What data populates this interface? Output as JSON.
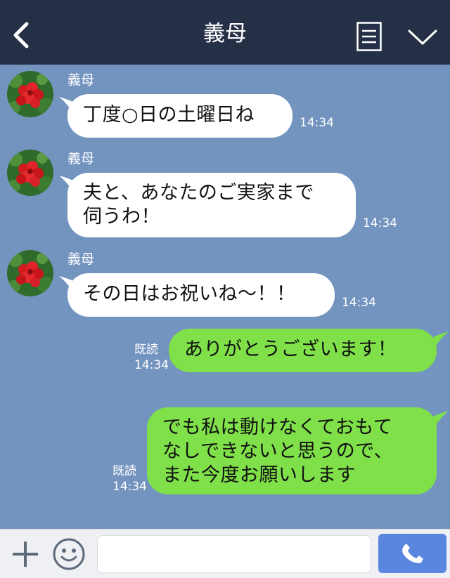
{
  "header": {
    "title": "義母",
    "back_icon": "chevron-left-icon",
    "menu_icon": "list-icon",
    "collapse_icon": "chevron-down-icon",
    "background": "#253047"
  },
  "chat": {
    "background": "#7494c0",
    "incoming": [
      {
        "sender": "義母",
        "text": "丁度○日の土曜日ね",
        "time": "14:34"
      },
      {
        "sender": "義母",
        "lines": [
          "夫と、あなたのご実家まで",
          "伺うわ！"
        ],
        "time": "14:34"
      },
      {
        "sender": "義母",
        "text": "その日はお祝いね〜！！",
        "time": "14:34"
      }
    ],
    "outgoing": [
      {
        "read_label": "既読",
        "text": "ありがとうございます！",
        "time": "14:34"
      },
      {
        "read_label": "既読",
        "lines": [
          "でも私は動けなくておもて",
          "なしできないと思うので、",
          "また今度お願いします"
        ],
        "time": "14:34"
      }
    ],
    "incoming_bubble_color": "#ffffff",
    "outgoing_bubble_color": "#7fe04a"
  },
  "footer": {
    "plus_icon": "plus-icon",
    "emoji_icon": "emoji-icon",
    "input_placeholder": "",
    "call_icon": "phone-icon",
    "call_color": "#5a86e0"
  }
}
